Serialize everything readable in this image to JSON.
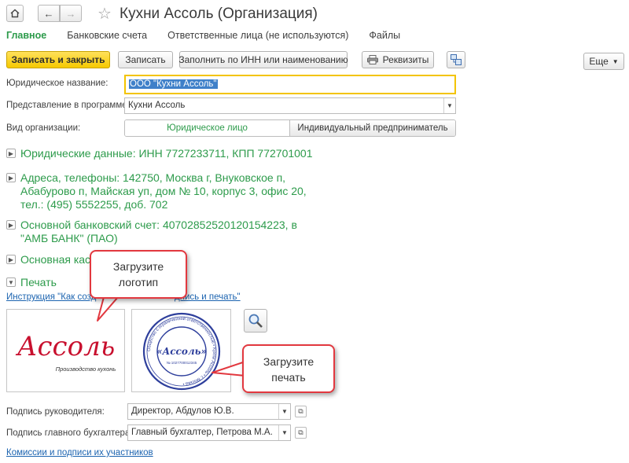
{
  "window": {
    "title": "Кухни Ассоль (Организация)"
  },
  "tabs": [
    {
      "label": "Главное",
      "active": true
    },
    {
      "label": "Банковские счета"
    },
    {
      "label": "Ответственные лица (не используются)"
    },
    {
      "label": "Файлы"
    }
  ],
  "toolbar": {
    "save_close_label": "Записать и закрыть",
    "save_label": "Записать",
    "fill_label": "Заполнить по ИНН или наименованию",
    "details_label": "Реквизиты",
    "more_label": "Еще"
  },
  "form": {
    "legal_name_label": "Юридическое название:",
    "legal_name_value": "ООО \"Кухни Ассоль\"",
    "display_label": "Представление в программе:",
    "display_value": "Кухни Ассоль",
    "org_type_label": "Вид организации:",
    "org_type_options": [
      "Юридическое лицо",
      "Индивидуальный предприниматель"
    ]
  },
  "sections": {
    "legal": "Юридические данные: ИНН 7727233711, КПП 772701001",
    "address_line1": "Адреса, телефоны: 142750, Москва г, Внуковское п,",
    "address_line2": "Абабурово п, Майская уп, дом № 10, корпус 3, офис 20,",
    "address_line3": "тел.: (495) 5552255, доб. 702",
    "bank_line1": "Основной банковский счет: 40702852520120154223, в",
    "bank_line2": "\"АМБ БАНК\" (ПАО)",
    "cash": "Основная кас",
    "print": "Печать"
  },
  "print": {
    "instruction_link_start": "Инструкция \"Как созд",
    "instruction_link_end": "дпись и печать\"",
    "logo_text": "Ассоль",
    "logo_subtitle": "Производство кухонь",
    "stamp_center": "«Ассоль»",
    "stamp_ring": "Общество с ограниченной ответственностью • Кухни Ассоль • г. Москва •",
    "stamp_number": "№ 1027700012345"
  },
  "signatures": {
    "director_label": "Подпись руководителя:",
    "director_value": "Директор, Абдулов Ю.В.",
    "accountant_label": "Подпись главного бухгалтера:",
    "accountant_value": "Главный бухгалтер, Петрова М.А.",
    "commissions_link": "Комиссии и подписи их участников"
  },
  "callouts": {
    "logo": [
      "Загрузите",
      "логотип"
    ],
    "stamp": [
      "Загрузите",
      "печать"
    ]
  },
  "colors": {
    "accent_green": "#2d9b4b",
    "primary_yellow": "#f6c900",
    "callout_red": "#e2383f",
    "link_blue": "#1c64b0",
    "logo_red": "#c8102e",
    "stamp_blue": "#2e3f9c"
  }
}
